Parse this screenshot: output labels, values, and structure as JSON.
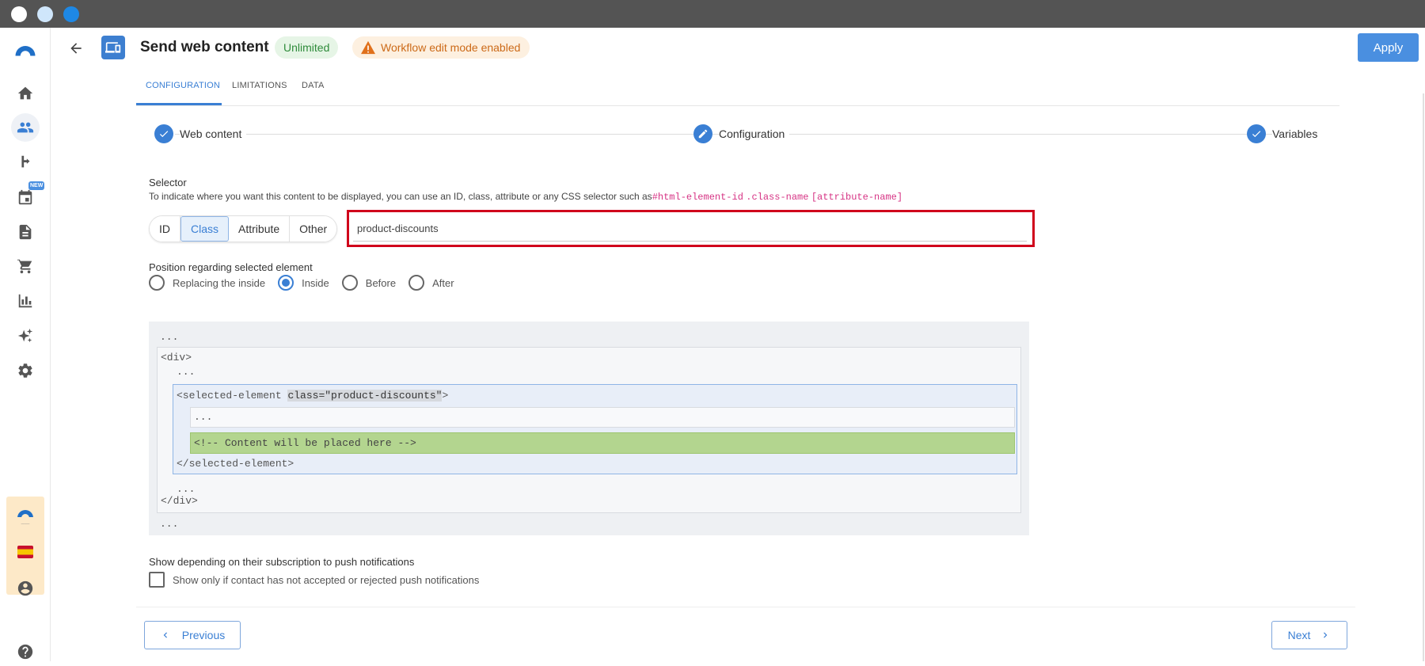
{
  "header": {
    "title": "Send web content",
    "badge_unlimited": "Unlimited",
    "badge_warning": "Workflow edit mode enabled",
    "apply_label": "Apply"
  },
  "sidebar": {
    "new_badge": "NEW",
    "items": [
      "home-icon",
      "people-icon",
      "workflow-icon",
      "calendar-icon",
      "document-icon",
      "cart-icon",
      "chart-icon",
      "sparkle-icon",
      "gear-icon"
    ],
    "active": "people-icon"
  },
  "tabs": [
    {
      "label": "CONFIGURATION",
      "active": true
    },
    {
      "label": "LIMITATIONS",
      "active": false
    },
    {
      "label": "DATA",
      "active": false
    }
  ],
  "stepper": [
    {
      "label": "Web content",
      "state": "done"
    },
    {
      "label": "Configuration",
      "state": "editing"
    },
    {
      "label": "Variables",
      "state": "done"
    }
  ],
  "selector": {
    "title": "Selector",
    "description": "To indicate where you want this content to be displayed, you can use an ID, class, attribute or any CSS selector such as",
    "hint1": "#html-element-id",
    "hint2": ".class-name",
    "hint3": "[attribute-name]",
    "types": [
      "ID",
      "Class",
      "Attribute",
      "Other"
    ],
    "selected_type": "Class",
    "value": "product-discounts"
  },
  "position": {
    "title": "Position regarding selected element",
    "options": [
      "Replacing the inside",
      "Inside",
      "Before",
      "After"
    ],
    "selected": "Inside"
  },
  "preview": {
    "dots": "...",
    "div_open": "<div>",
    "div_close": "</div>",
    "sel_open_start": "<selected-element ",
    "sel_class_attr": "class=\"product-discounts\"",
    "sel_open_end": ">",
    "sel_close": "</selected-element>",
    "content_comment": "<!-- Content will be placed here -->"
  },
  "push": {
    "title": "Show depending on their subscription to push notifications",
    "checkbox_label": "Show only if contact has not accepted or rejected push notifications",
    "checked": false
  },
  "footer": {
    "previous_label": "Previous",
    "next_label": "Next"
  },
  "colors": {
    "accent": "#3a7fd4",
    "apply": "#4a8fe0",
    "highlight_border": "#d0021b",
    "content_green": "#b3d58f"
  }
}
